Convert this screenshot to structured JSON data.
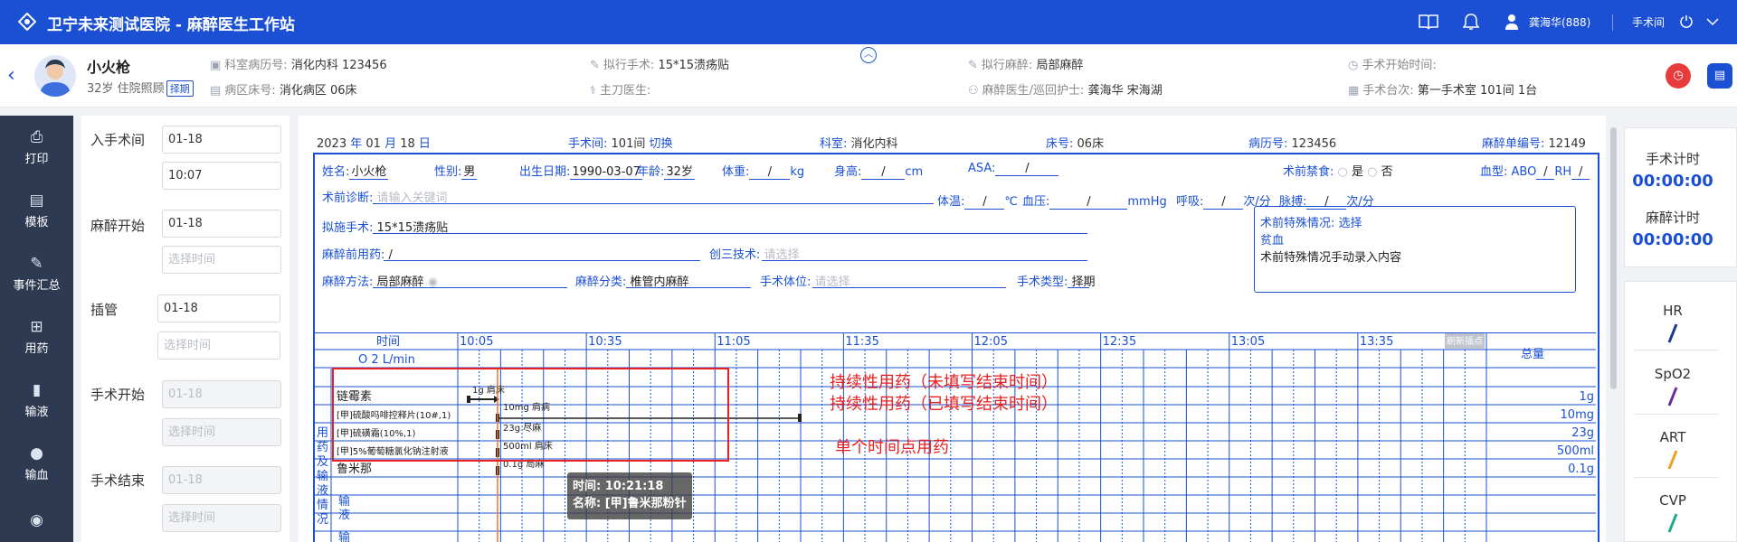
{
  "app": {
    "title": "卫宁未来测试医院 - 麻醉医生工作站",
    "user": "龚海华(888)",
    "room_menu": "手术间"
  },
  "patient": {
    "name": "小火枪",
    "info": "32岁 住院照顾",
    "badge": "择期",
    "dept_record_label": "科室病历号:",
    "dept_record": "消化内科 123456",
    "ward_bed_label": "病区床号:",
    "ward_bed": "消化病区 06床",
    "planned_op_label": "拟行手术:",
    "planned_op": "15*15溃疡贴",
    "surgeon_label": "主刀医生:",
    "surgeon": "",
    "planned_anes_label": "拟行麻醉:",
    "planned_anes": "局部麻醉",
    "anes_staff_label": "麻醉医生/巡回护士:",
    "anes_staff": "龚海华 宋海湖",
    "op_start_label": "手术开始时间:",
    "op_start": "",
    "op_room_label": "手术台次:",
    "op_room": "第一手术室 101间 1台"
  },
  "sidebar": {
    "items": [
      {
        "label": "打印",
        "icon": "print-icon"
      },
      {
        "label": "模板",
        "icon": "template-icon"
      },
      {
        "label": "事件汇总",
        "icon": "events-icon"
      },
      {
        "label": "用药",
        "icon": "medication-icon"
      },
      {
        "label": "输液",
        "icon": "infusion-icon"
      },
      {
        "label": "输血",
        "icon": "blood-icon"
      }
    ]
  },
  "timepanel": {
    "enter_label": "入手术间",
    "enter_date": "01-18",
    "enter_time": "10:07",
    "anes_start_label": "麻醉开始",
    "anes_start_date": "01-18",
    "anes_start_time_ph": "选择时间",
    "intub_label": "插管",
    "intub_date": "01-18",
    "intub_time_ph": "选择时间",
    "op_start_label": "手术开始",
    "op_start_date": "01-18",
    "op_start_time_ph": "选择时间",
    "op_end_label": "手术结束",
    "op_end_date": "01-18",
    "op_end_time_ph": "选择时间"
  },
  "sheet": {
    "year": "2023",
    "year_unit": "年",
    "month": "01",
    "month_unit": "月",
    "day": "18",
    "day_unit": "日",
    "room_label": "手术间:",
    "room": "101间",
    "room_switch": "切换",
    "dept_label": "科室:",
    "dept": "消化内科",
    "bed_label": "床号:",
    "bed": "06床",
    "record_label": "病历号:",
    "record": "123456",
    "sheet_no_label": "麻醉单编号:",
    "sheet_no": "12149"
  },
  "form": {
    "name_label": "姓名:",
    "name": "小火枪",
    "sex_label": "性别:",
    "sex": "男",
    "dob_label": "出生日期:",
    "dob": "1990-03-07",
    "age_label": "年龄:",
    "age": "32岁",
    "weight_label": "体重:",
    "weight": "/",
    "weight_unit": "kg",
    "height_label": "身高:",
    "height": "/",
    "height_unit": "cm",
    "asa_label": "ASA:",
    "asa": "/",
    "fasting_label": "术前禁食:",
    "fasting_yes": "是",
    "fasting_no": "否",
    "blood_label": "血型:",
    "abo_label": "ABO",
    "abo": "/",
    "rh_label": "RH",
    "rh": "/",
    "diag_label": "术前诊断:",
    "diag_ph": "请输入关键词",
    "temp_label": "体温:",
    "temp": "/",
    "temp_unit": "℃",
    "bp_label": "血压:",
    "bp": "/",
    "bp_unit": "mmHg",
    "resp_label": "呼吸:",
    "resp": "/",
    "resp_unit": "次/分",
    "pulse_label": "脉搏:",
    "pulse": "/",
    "pulse_unit": "次/分",
    "planned_op_label": "拟施手术:",
    "planned_op": "15*15溃疡贴",
    "premed_label": "麻醉前用药:",
    "premed": "/",
    "invasive_label": "创三技术:",
    "invasive_ph": "请选择",
    "method_label": "麻醉方法:",
    "method": "局部麻醉",
    "class_label": "麻醉分类:",
    "class": "椎管内麻醉",
    "position_label": "手术体位:",
    "position_ph": "请选择",
    "optype_label": "手术类型:",
    "optype": "择期",
    "special_label": "术前特殊情况:",
    "special_link": "选择",
    "special_item": "贫血",
    "special_text": "术前特殊情况手动录入内容"
  },
  "grid": {
    "time_label": "时间",
    "o2_label": "O 2 L/min",
    "times": [
      "10:05",
      "10:35",
      "11:05",
      "11:35",
      "12:05",
      "12:35",
      "13:05",
      "13:35"
    ],
    "refresh": "刷新插点",
    "total_label": "总量",
    "section_label": "用药及输液情况",
    "infusion_label": "输液",
    "blood_label": "输血",
    "drugs": [
      {
        "name": "链霉素",
        "dose": "1g 肩床",
        "total": "1g"
      },
      {
        "name": "[甲]硫酸吗啡控释片(10#,1)",
        "dose": "10mg 肩病",
        "total": "10mg"
      },
      {
        "name": "[甲]硫磺霜(10%,1)",
        "dose": "23g 尽麻",
        "total": "23g"
      },
      {
        "name": "[甲]5%葡萄糖氯化钠注射液",
        "dose": "500ml 肩床",
        "total": "500ml"
      },
      {
        "name": "鲁米那",
        "dose": "0.1g 局麻",
        "total": "0.1g"
      }
    ],
    "note1": "持续性用药（未填写结束时间）",
    "note2": "持续性用药（已填写结束时间）",
    "note3": "单个时间点用药",
    "tooltip_time": "时间: 10:21:18",
    "tooltip_name": "名称: [甲]鲁米那粉针"
  },
  "timers": {
    "op_label": "手术计时",
    "op_value": "00:00:00",
    "anes_label": "麻醉计时",
    "anes_value": "00:00:00"
  },
  "vitals": [
    {
      "label": "HR",
      "color": "#1a3a8a"
    },
    {
      "label": "SpO2",
      "color": "#6a2aa0"
    },
    {
      "label": "ART",
      "color": "#f0a020"
    },
    {
      "label": "CVP",
      "color": "#1fa88a"
    }
  ],
  "colors": {
    "brand": "#1b50d4",
    "sidebar": "#2e3a52",
    "annotation": "#e62121"
  }
}
